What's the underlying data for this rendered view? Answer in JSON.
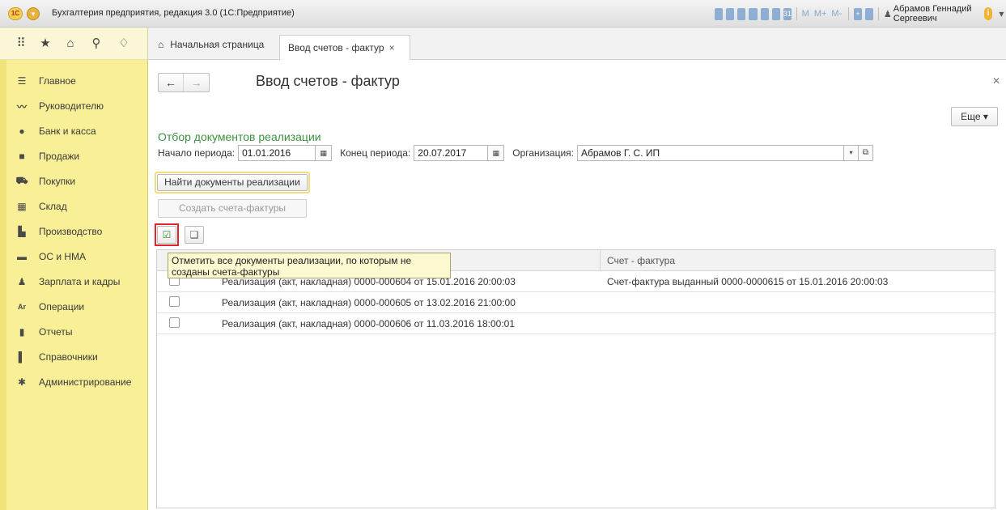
{
  "window": {
    "title": "Бухгалтерия предприятия, редакция 3.0 (1С:Предприятие)",
    "user": "Абрамов Геннадий Сергеевич",
    "toolbar_texts": [
      "M",
      "M+",
      "M-"
    ]
  },
  "sidebar": {
    "items": [
      {
        "label": "Главное",
        "icon": "menu-lines-icon"
      },
      {
        "label": "Руководителю",
        "icon": "trend-icon"
      },
      {
        "label": "Банк и касса",
        "icon": "coin-icon"
      },
      {
        "label": "Продажи",
        "icon": "bag-icon"
      },
      {
        "label": "Покупки",
        "icon": "cart-icon"
      },
      {
        "label": "Склад",
        "icon": "warehouse-icon"
      },
      {
        "label": "Производство",
        "icon": "factory-icon"
      },
      {
        "label": "ОС и НМА",
        "icon": "truck-icon"
      },
      {
        "label": "Зарплата и кадры",
        "icon": "person-icon"
      },
      {
        "label": "Операции",
        "icon": "operations-icon"
      },
      {
        "label": "Отчеты",
        "icon": "bar-chart-icon"
      },
      {
        "label": "Справочники",
        "icon": "book-icon"
      },
      {
        "label": "Администрирование",
        "icon": "gear-icon"
      }
    ]
  },
  "tabs": {
    "home": "Начальная страница",
    "active": "Ввод счетов - фактур",
    "close": "×"
  },
  "form": {
    "title": "Ввод счетов - фактур",
    "more": "Еще ▾",
    "section_title": "Отбор документов реализации",
    "period_start_label": "Начало периода:",
    "period_start": "01.01.2016",
    "period_end_label": "Конец периода:",
    "period_end": "20.07.2017",
    "org_label": "Организация:",
    "org_value": "Абрамов Г. С. ИП",
    "find_button": "Найти документы реализации",
    "create_button": "Создать счета-фактуры"
  },
  "table": {
    "headers": [
      "",
      "Счет - фактура"
    ],
    "rows": [
      {
        "doc": "Реализация (акт, накладная) 0000-000604 от 15.01.2016 20:00:03",
        "invoice": "Счет-фактура выданный 0000-0000615 от 15.01.2016 20:00:03"
      },
      {
        "doc": "Реализация (акт, накладная) 0000-000605 от 13.02.2016 21:00:00",
        "invoice": ""
      },
      {
        "doc": "Реализация (акт, накладная) 0000-000606 от 11.03.2016 18:00:01",
        "invoice": ""
      }
    ]
  },
  "tooltip": {
    "text": "Отметить все документы реализации, по которым не созданы счета-фактуры"
  }
}
